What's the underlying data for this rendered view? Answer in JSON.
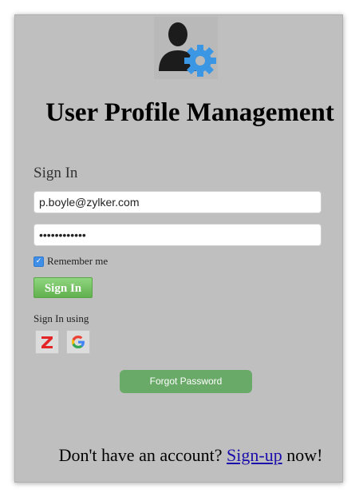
{
  "header": {
    "logo_icon": "user-settings-icon",
    "title": "User Profile Management"
  },
  "signin": {
    "heading": "Sign In",
    "email_value": "p.boyle@zylker.com",
    "password_masked": "••••••••••••",
    "remember_label": "Remember me",
    "remember_checked": true,
    "button_label": "Sign In"
  },
  "social": {
    "label": "Sign In using",
    "providers": [
      {
        "name": "Zoho",
        "icon": "zoho-z-icon"
      },
      {
        "name": "Google",
        "icon": "google-g-icon"
      }
    ]
  },
  "forgot": {
    "label": "Forgot Password"
  },
  "signup": {
    "prefix": "Don't have an account?",
    "link": "Sign-up",
    "suffix": "now!"
  },
  "colors": {
    "panel_bg": "#bfbfbf",
    "primary_green": "#62b04e",
    "forgot_green": "#6aaa68",
    "link_blue": "#1a0dab",
    "gear_blue": "#3b96e3"
  }
}
